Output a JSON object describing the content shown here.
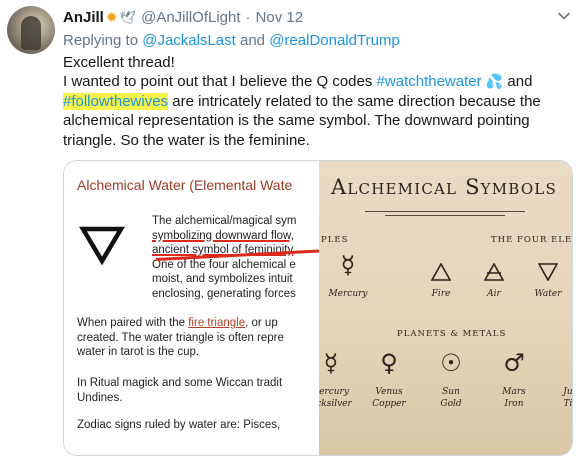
{
  "tweet": {
    "author_name": "AnJill",
    "author_emojis": [
      "sun-emoji",
      "dove-emoji"
    ],
    "handle": "@AnJillOfLight",
    "separator": "·",
    "date": "Nov 12",
    "replying_prefix": "Replying to",
    "reply_to_1": "@JackalsLast",
    "reply_and": "and",
    "reply_to_2": "@realDonaldTrump",
    "text_line1": "Excellent thread!",
    "text_line2_pre": "I wanted to point out that I believe the Q codes ",
    "hashtag_water": "#watchthewater",
    "text_line2_post": " and",
    "hashtag_wives": "#followthewives",
    "text_line3_post": " are intricately related to the same direction because the",
    "text_line4": "alchemical representation is the same symbol. The downward pointing",
    "text_line5": "triangle. So the water is the feminine."
  },
  "card_left": {
    "title": "Alchemical Water (Elemental Wate",
    "def_line1": "The alchemical/magical sym",
    "def_line2": "symbolizing downward flow,",
    "def_line3": "ancient symbol of femininity",
    "def_line4": "One of the four alchemical e",
    "def_line5": "moist, and symbolizes intuit",
    "def_line6": "enclosing, generating forces",
    "para2_line1_pre": "When paired with the ",
    "para2_link": "fire triangle",
    "para2_line1_post": ", or up",
    "para2_line2": "created. The water triangle is often repre",
    "para2_line3": "water in tarot is the cup.",
    "para3_line1": "In Ritual magick and some Wiccan tradit",
    "para3_line2": "Undines.",
    "para4_line1": "Zodiac signs ruled by water are: Pisces, "
  },
  "card_right": {
    "title": "Alchemical Symbols",
    "section_elements_left": "PLES",
    "section_elements_right": "THE FOUR ELE",
    "section_planets": "PLANETS & METALS",
    "mercury_top_label": "Mercury",
    "fire_label": "Fire",
    "air_label": "Air",
    "water_label": "Water",
    "mercury_bottom_label_1": "ercury",
    "mercury_bottom_label_2": "cksilver",
    "venus_label_1": "Venus",
    "venus_label_2": "Copper",
    "sun_label_1": "Sun",
    "sun_label_2": "Gold",
    "mars_label_1": "Mars",
    "mars_label_2": "Iron",
    "jupiter_label_1": "Ju",
    "jupiter_label_2": "Ti"
  },
  "colors": {
    "link_blue": "#1b95e0",
    "highlight_yellow": "#f6f34a",
    "muted_gray": "#657786",
    "card_title_red": "#9e3a2a",
    "underline_red": "#d92a1c"
  }
}
